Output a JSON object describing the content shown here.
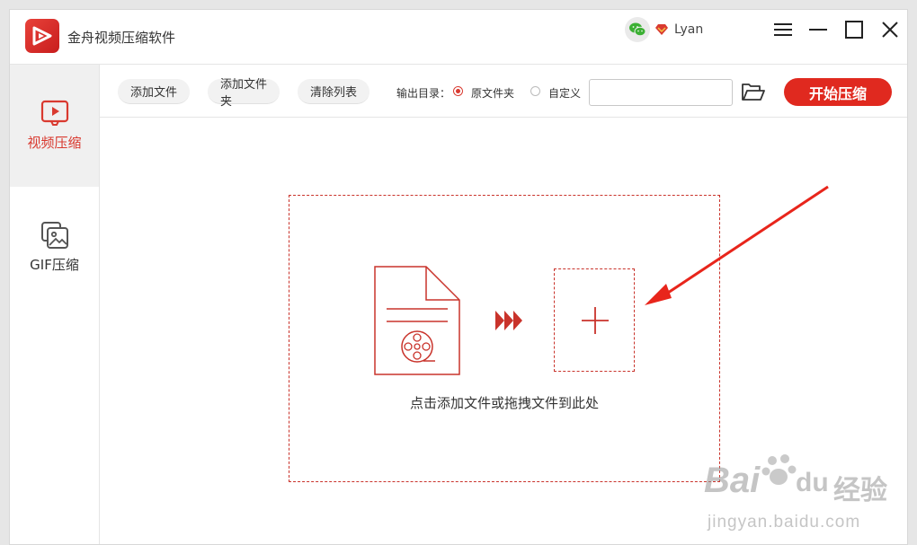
{
  "app": {
    "title": "金舟视频压缩软件",
    "user_name": "Lyan",
    "brand_color": "#e0291f"
  },
  "window_controls": {
    "menu_icon": "menu-icon",
    "minimize_icon": "minimize-icon",
    "maximize_icon": "maximize-icon",
    "close_icon": "close-icon"
  },
  "sidebar": {
    "items": [
      {
        "label": "视频压缩",
        "icon": "video-play-icon",
        "active": true
      },
      {
        "label": "GIF压缩",
        "icon": "gif-image-icon",
        "active": false
      }
    ]
  },
  "toolbar": {
    "add_file": "添加文件",
    "add_folder": "添加文件夹",
    "clear_list": "清除列表",
    "output_label": "输出目录：",
    "option_original": "原文件夹",
    "option_custom": "自定义",
    "selected_option": "原文件夹",
    "path_value": "",
    "start_label": "开始压缩"
  },
  "dropzone": {
    "hint": "点击添加文件或拖拽文件到此处"
  },
  "watermark": {
    "brand": "Bai",
    "brand2": "du",
    "suffix": "经验",
    "url": "jingyan.baidu.com"
  }
}
